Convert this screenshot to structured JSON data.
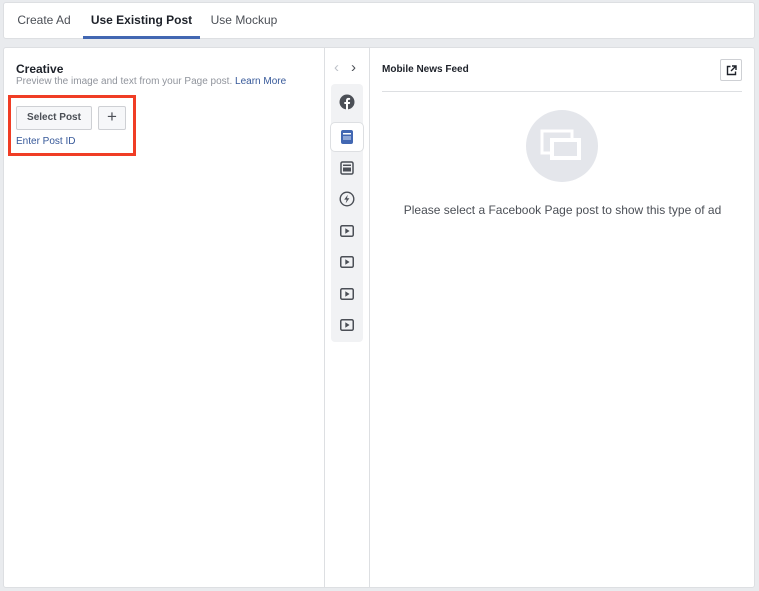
{
  "tabs": [
    {
      "label": "Create Ad",
      "active": false
    },
    {
      "label": "Use Existing Post",
      "active": true
    },
    {
      "label": "Use Mockup",
      "active": false
    }
  ],
  "creative": {
    "title": "Creative",
    "description": "Preview the image and text from your Page post.",
    "learn_more": "Learn More",
    "select_post": "Select Post",
    "add_label": "+",
    "enter_post_id": "Enter Post ID"
  },
  "preview": {
    "prev_label": "‹",
    "next_label": "›",
    "placements": [
      {
        "icon": "facebook-icon",
        "selected": false
      },
      {
        "icon": "mobile-feed-icon",
        "selected": true
      },
      {
        "icon": "desktop-feed-icon",
        "selected": false
      },
      {
        "icon": "messenger-icon",
        "selected": false
      },
      {
        "icon": "video-icon",
        "selected": false
      },
      {
        "icon": "video-icon",
        "selected": false
      },
      {
        "icon": "video-icon",
        "selected": false
      },
      {
        "icon": "video-icon",
        "selected": false
      }
    ],
    "title": "Mobile News Feed",
    "empty_message": "Please select a Facebook Page post to show this type of ad"
  },
  "colors": {
    "accent": "#4267b2",
    "link": "#365899",
    "highlight": "#f03d25",
    "selected_icon": "#4267b2"
  }
}
